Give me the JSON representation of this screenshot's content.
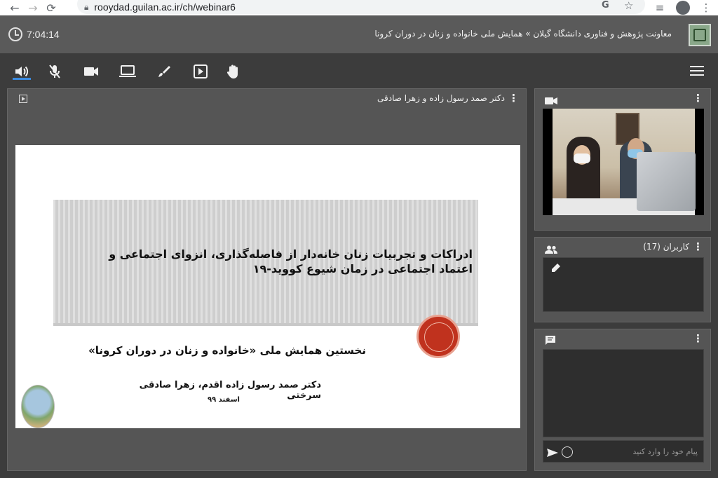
{
  "browser": {
    "url": "rooydad.guilan.ac.ir/ch/webinar6"
  },
  "header": {
    "timer": "7:04:14",
    "breadcrumb": "معاونت پژوهش و فناوری دانشگاه گیلان » همایش ملی خانواده و زنان در دوران کرونا"
  },
  "toolbar": {
    "icons": [
      "speaker-icon",
      "mic-off-icon",
      "camera-icon",
      "screen-share-icon",
      "brush-icon",
      "play-icon",
      "hand-icon",
      "menu-icon"
    ],
    "accent": "#3b8be0"
  },
  "main_panel": {
    "title": "دکتر صمد رسول زاده و زهرا صادقی",
    "slide": {
      "title_line1": "ادراکات و تجربیات زنان خانه‌دار از فاصله‌گذاری، انزوای اجتماعی و",
      "title_line2": "اعتماد اجتماعی در زمان شیوع کووید-۱۹",
      "subtitle": "نخستین همایش ملی «خانواده و زنان در دوران کرونا»",
      "authors": "دکتر صمد رسول زاده اقدم، زهرا صادقی سرختی",
      "date": "اسفند ۹۹",
      "seal_color": "#c0321e"
    }
  },
  "users_panel": {
    "title": "کاربران (17)"
  },
  "chat_panel": {
    "placeholder": "پیام خود را وارد کنید"
  }
}
